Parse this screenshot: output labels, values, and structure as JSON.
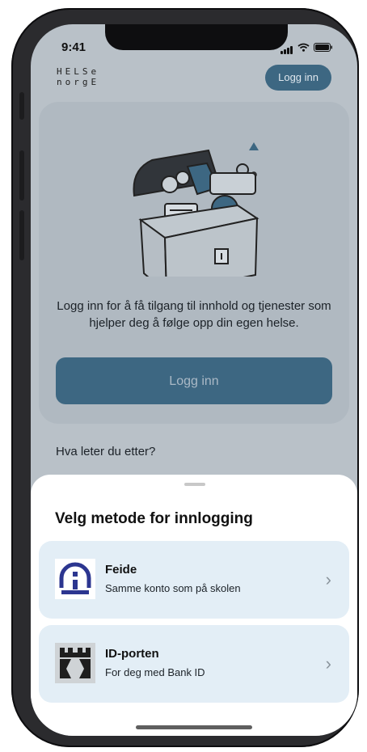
{
  "status": {
    "time": "9:41"
  },
  "header": {
    "logo_line1": "HELSe",
    "logo_line2": "norgE",
    "login_label": "Logg inn"
  },
  "card": {
    "illustration": "treasure-chest",
    "text": "Logg inn for å få tilgang til innhold og tjenester som hjelper deg å følge opp din egen helse.",
    "login_label": "Logg inn"
  },
  "search": {
    "label": "Hva leter du etter?"
  },
  "sheet": {
    "title": "Velg metode for innlogging",
    "options": [
      {
        "title": "Feide",
        "subtitle": "Samme konto som på skolen",
        "icon": "feide-icon"
      },
      {
        "title": "ID-porten",
        "subtitle": "For deg med Bank ID",
        "icon": "id-porten-icon"
      }
    ]
  },
  "colors": {
    "primary": "#3d6782",
    "overlay_bg": "#b9c1c8",
    "option_bg": "#e3eef6"
  }
}
